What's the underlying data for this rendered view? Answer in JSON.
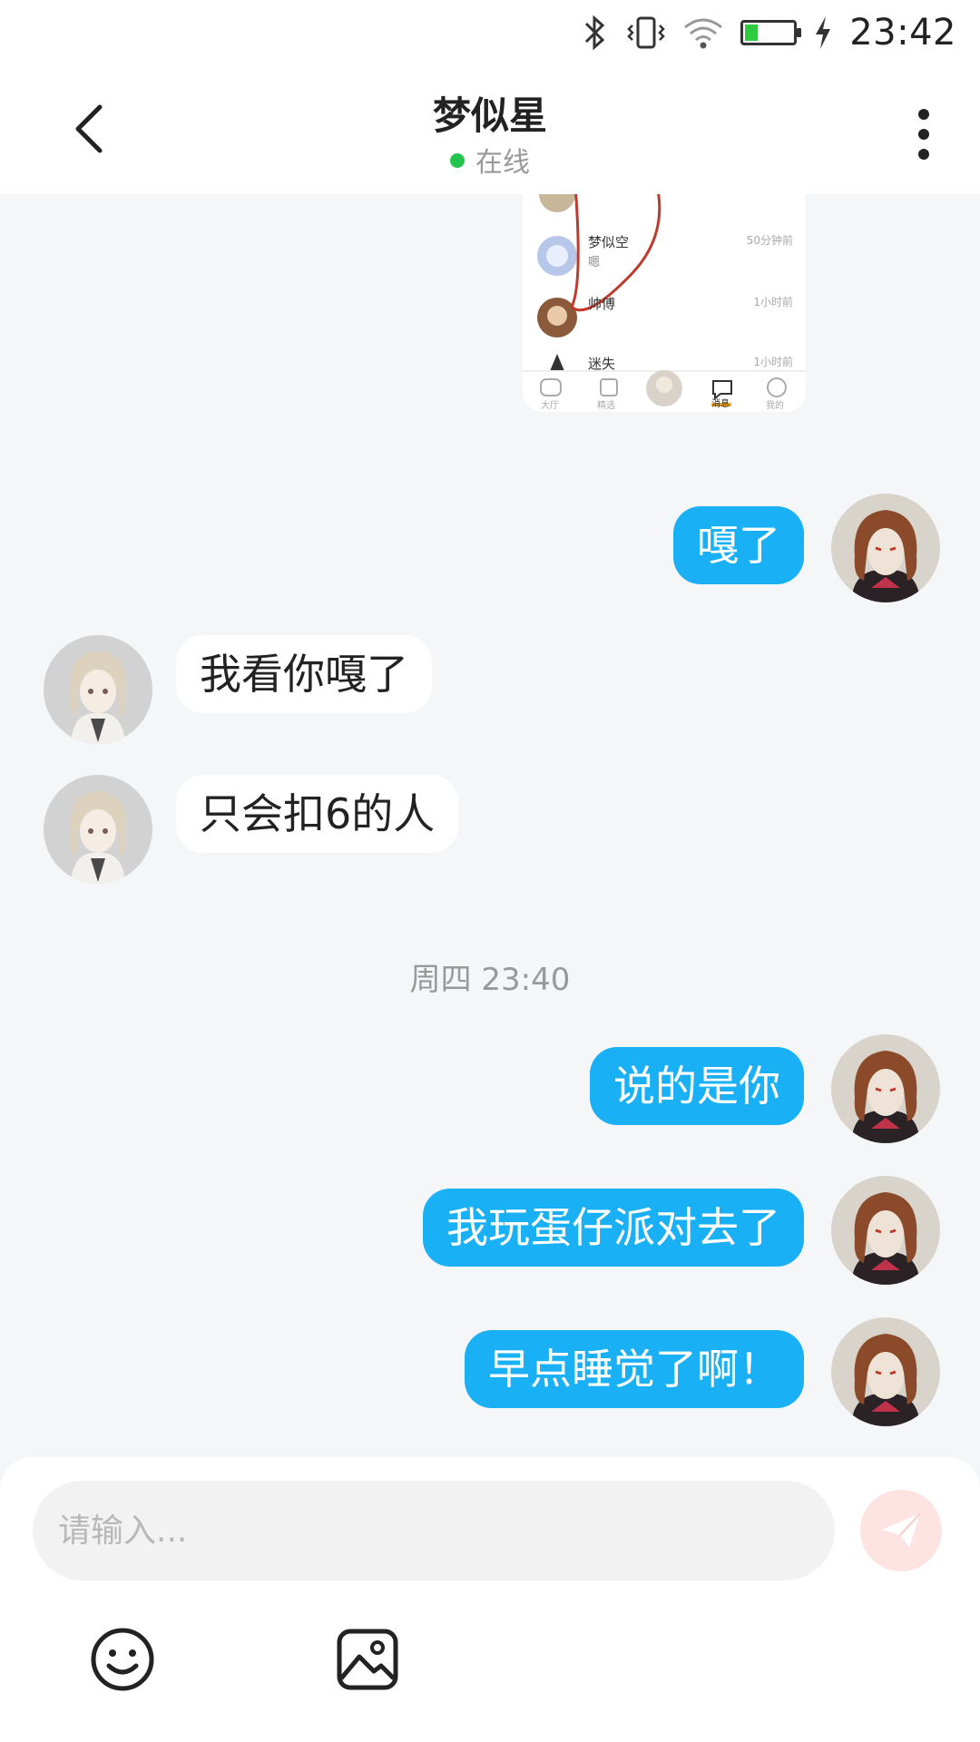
{
  "status_bar": {
    "time": "23:42",
    "icons": [
      "bluetooth-icon",
      "vibrate-icon",
      "wifi-icon",
      "battery-icon",
      "charging-icon"
    ],
    "battery_level": 0.25
  },
  "header": {
    "title": "梦似星",
    "status": "在线",
    "status_color": "#22c44e"
  },
  "shared_image": {
    "rows": [
      {
        "name": "梦似空",
        "preview": "嗯",
        "time": "50分钟前"
      },
      {
        "name": "帅傅",
        "preview": "",
        "time": "1小时前"
      },
      {
        "name": "迷失",
        "preview": "",
        "time": "1小时前"
      }
    ],
    "tabs": [
      "大厅",
      "精选",
      "",
      "消息",
      "我的"
    ]
  },
  "messages": [
    {
      "direction": "out",
      "text": "嘎了"
    },
    {
      "direction": "in",
      "text": "我看你嘎了"
    },
    {
      "direction": "in",
      "text": "只会扣6的人"
    },
    {
      "direction": "out",
      "text": "说的是你"
    },
    {
      "direction": "out",
      "text": "我玩蛋仔派对去了"
    },
    {
      "direction": "out",
      "text": "早点睡觉了啊！"
    }
  ],
  "timestamp": "周四 23:40",
  "input": {
    "placeholder": "请输入...",
    "value": ""
  },
  "colors": {
    "accent": "#1ab0f5",
    "background": "#f5f6f8",
    "send_button": "#fde3e1"
  }
}
